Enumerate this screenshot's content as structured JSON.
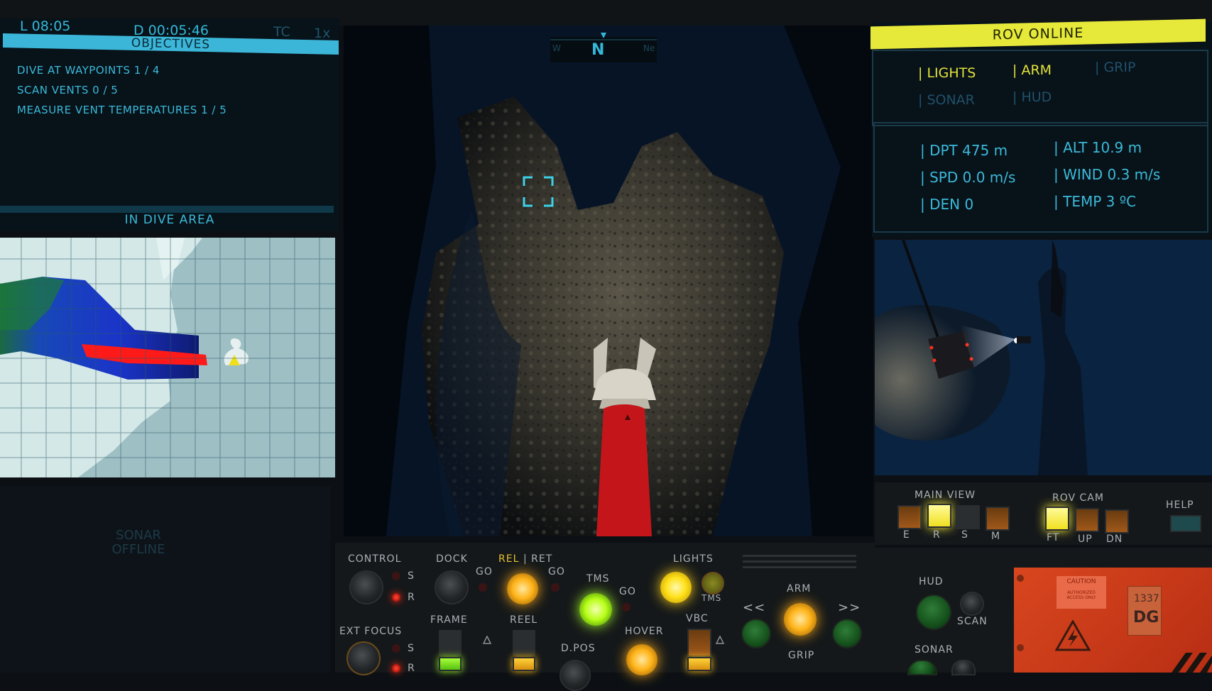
{
  "header": {
    "local_time": "L 08:05",
    "dive_time": "D 00:05:46",
    "tc_label": "TC",
    "speed_label": "1x"
  },
  "objectives": {
    "title": "OBJECTIVES",
    "items": [
      "DIVE AT WAYPOINTS 1 / 4",
      "SCAN VENTS 0 / 5",
      "MEASURE VENT TEMPERATURES 1 / 5"
    ],
    "area_status": "IN DIVE AREA"
  },
  "sonar": {
    "status_line1": "SONAR",
    "status_line2": "OFFLINE"
  },
  "compass": {
    "heading": "N",
    "left_mark": "W",
    "right_mark": "Ne"
  },
  "rov": {
    "status": "ROV ONLINE",
    "tabs": [
      {
        "label": "| LIGHTS",
        "active": true
      },
      {
        "label": "| ARM",
        "active": true
      },
      {
        "label": "| GRIP",
        "active": false
      },
      {
        "label": "| SONAR",
        "active": false
      },
      {
        "label": "| HUD",
        "active": false
      }
    ],
    "telemetry": {
      "depth": "| DPT 475 m",
      "altitude": "| ALT 10.9 m",
      "speed": "| SPD 0.0 m/s",
      "wind": "| WIND 0.3 m/s",
      "density": "| DEN  0",
      "temperature": "| TEMP 3 ºC"
    }
  },
  "console": {
    "control": "CONTROL",
    "s1": "S",
    "r1": "R",
    "dock": "DOCK",
    "go1": "GO",
    "rel": "REL",
    "ret": "| RET",
    "go2": "GO",
    "tms": "TMS",
    "go3": "GO",
    "lights": "LIGHTS",
    "tms2": "TMS",
    "ext_focus": "EXT FOCUS",
    "s2": "S",
    "r2": "R",
    "frame": "FRAME",
    "reel": "REEL",
    "dpos": "D.POS",
    "hover": "HOVER",
    "vbc": "VBC",
    "arm": "ARM",
    "left": "<<",
    "right": ">>",
    "grip": "GRIP",
    "main_view": "MAIN  VIEW",
    "mv_e": "E",
    "mv_r": "R",
    "mv_s": "S",
    "mv_m": "M",
    "rov_cam": "ROV  CAM",
    "cam_ft": "FT",
    "cam_up": "UP",
    "cam_dn": "DN",
    "help": "HELP",
    "hud": "HUD",
    "scan": "SCAN",
    "sonar": "SONAR",
    "caution_title": "CAUTION",
    "caution_text": "AUTHORIZED ACCESS ONLY",
    "plate_number": "1337",
    "plate_code": "DG"
  },
  "colors": {
    "hud_cyan": "#35b8d8",
    "status_yellow": "#e6e83a",
    "warning_orange": "#d8461e"
  }
}
